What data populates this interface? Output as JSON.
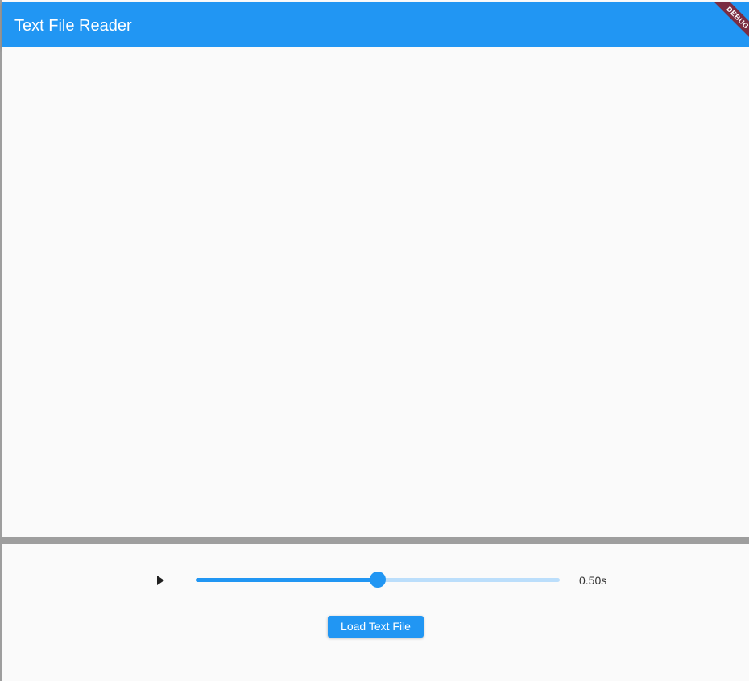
{
  "app_bar": {
    "title": "Text File Reader",
    "debug_banner": "DEBUG"
  },
  "playback": {
    "play_icon": "play-icon",
    "speed_slider": {
      "fraction": 0.5
    },
    "speed_label": "0.50s"
  },
  "actions": {
    "load_label": "Load Text File"
  },
  "colors": {
    "primary": "#2196f3",
    "primary_light": "#bbdefb",
    "debug_banner": "#7b2d42",
    "divider": "#9e9e9e",
    "background": "#fafafa"
  }
}
